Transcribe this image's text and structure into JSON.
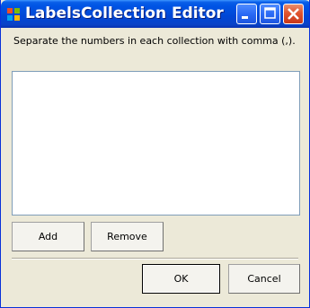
{
  "window": {
    "title": "LabelsCollection Editor",
    "app_icon": "windows-form-icon",
    "controls": [
      "minimize-icon",
      "maximize-icon",
      "close-icon"
    ]
  },
  "main": {
    "instruction": "Separate the numbers in each collection with comma (,).",
    "list_items": []
  },
  "buttons": {
    "add": "Add",
    "remove": "Remove",
    "ok": "OK",
    "cancel": "Cancel"
  },
  "colors": {
    "titlebar": "#0055e5",
    "window_bg": "#ece9d8",
    "close_button": "#e1542e",
    "listbox_border": "#7f9db9"
  }
}
